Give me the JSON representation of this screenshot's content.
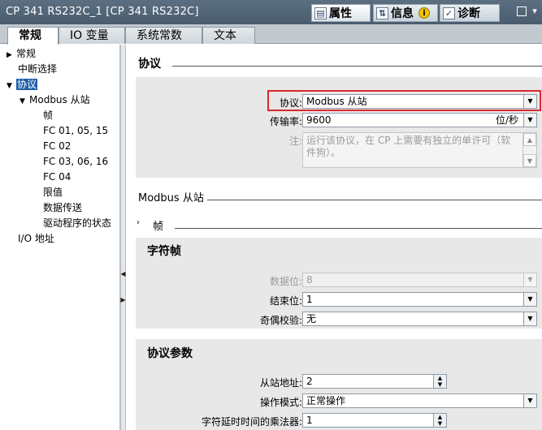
{
  "window": {
    "title": "CP 341 RS232C_1 [CP 341 RS232C]",
    "tabs": [
      {
        "label": "属性",
        "icon": "properties-icon"
      },
      {
        "label": "信息",
        "icon": "info-icon"
      },
      {
        "label": "诊断",
        "icon": "diagnostics-icon"
      }
    ]
  },
  "main_tabs": [
    {
      "label": "常规"
    },
    {
      "label": "IO 变量"
    },
    {
      "label": "系统常数"
    },
    {
      "label": "文本"
    }
  ],
  "nav": {
    "items": [
      {
        "label": "常规"
      },
      {
        "label": "中断选择"
      },
      {
        "label": "协议"
      },
      {
        "label": "Modbus 从站"
      },
      {
        "label": "帧"
      },
      {
        "label": "FC 01, 05, 15"
      },
      {
        "label": "FC 02"
      },
      {
        "label": "FC 03, 06, 16"
      },
      {
        "label": "FC 04"
      },
      {
        "label": "限值"
      },
      {
        "label": "数据传送"
      },
      {
        "label": "驱动程序的状态"
      },
      {
        "label": "I/O 地址"
      }
    ]
  },
  "protocol_section": {
    "title": "协议",
    "protocol_label": "协议:",
    "protocol_value": "Modbus 从站",
    "baud_label": "传输率:",
    "baud_value": "9600",
    "baud_unit": "位/秒",
    "note_label": "注:",
    "note_text": "运行该协议，在 CP 上需要有独立的单许可（软件狗）。"
  },
  "modbus_section": {
    "title": "Modbus 从站",
    "frame_title": "帧"
  },
  "char_frame": {
    "title": "字符帧",
    "data_bits_label": "数据位:",
    "data_bits_value": "8",
    "stop_bits_label": "结束位:",
    "stop_bits_value": "1",
    "parity_label": "奇偶校验:",
    "parity_value": "无"
  },
  "protocol_params": {
    "title": "协议参数",
    "slave_addr_label": "从站地址:",
    "slave_addr_value": "2",
    "mode_label": "操作模式:",
    "mode_value": "正常操作",
    "delay_label": "字符延时时间的乘法器:",
    "delay_value": "1"
  },
  "colors": {
    "accent_selected": "#1e5fa8",
    "highlight_box": "#d9282f",
    "titlebar": "#4f6376"
  }
}
